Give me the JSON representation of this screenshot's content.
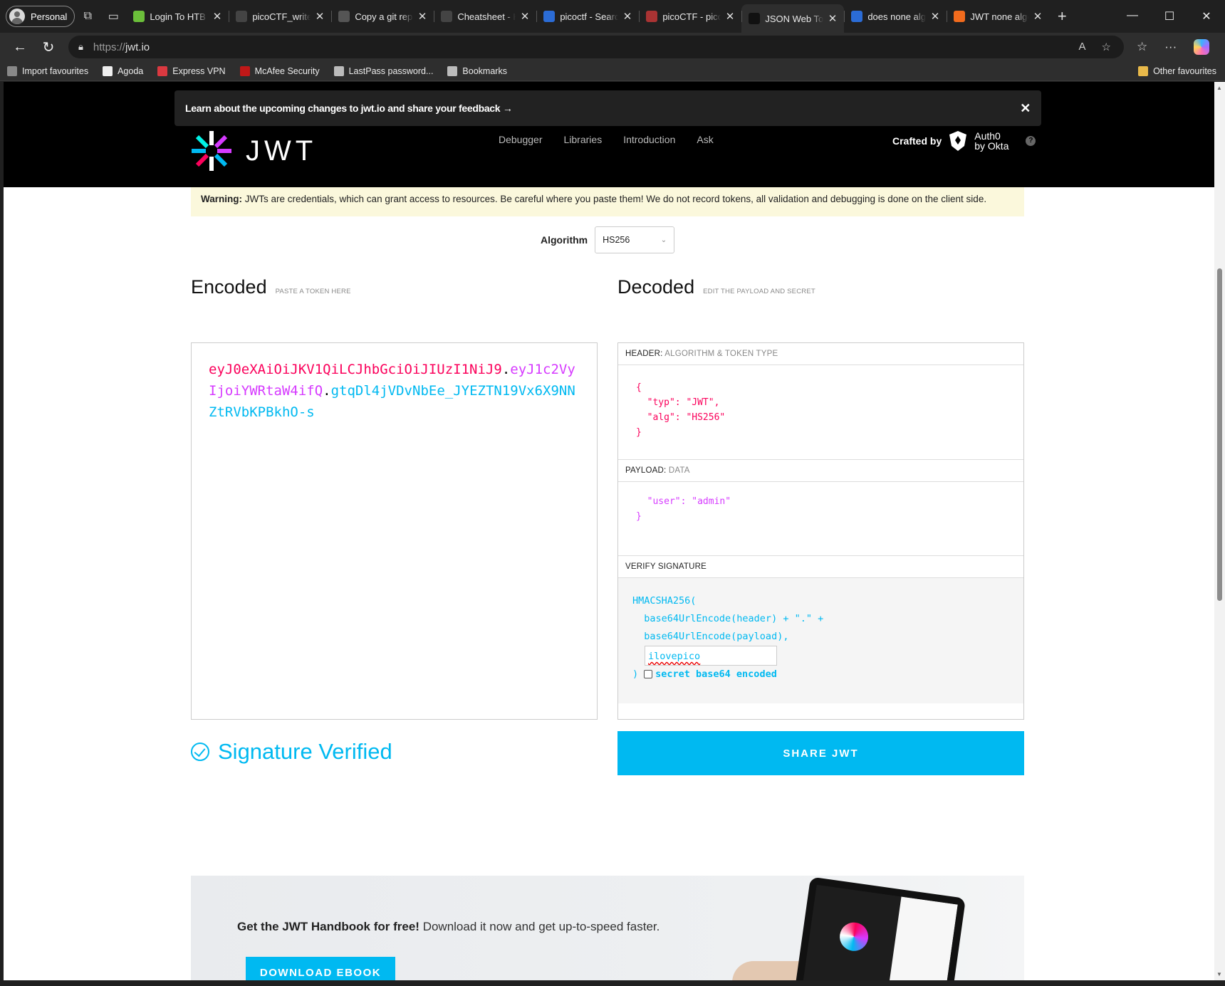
{
  "browser": {
    "profile": "Personal",
    "tabs": [
      {
        "title": "Login To HTB Ac",
        "color": "#6bbf3a"
      },
      {
        "title": "picoCTF_writeup",
        "color": "#444"
      },
      {
        "title": "Copy a git repo",
        "color": "#555"
      },
      {
        "title": "Cheatsheet - Ho",
        "color": "#444"
      },
      {
        "title": "picoctf - Search",
        "color": "#2b6cd6"
      },
      {
        "title": "picoCTF - picoG",
        "color": "#a33"
      },
      {
        "title": "JSON Web Toke",
        "color": "#111"
      },
      {
        "title": "does none algo",
        "color": "#2b6cd6"
      },
      {
        "title": "JWT none algor",
        "color": "#f26b1d"
      }
    ],
    "url_protocol": "https://",
    "url_host": "jwt.io",
    "bookmarks": [
      {
        "label": "Import favourites",
        "color": "#888"
      },
      {
        "label": "Agoda",
        "color": "#eee"
      },
      {
        "label": "Express VPN",
        "color": "#da3940"
      },
      {
        "label": "McAfee Security",
        "color": "#c01818"
      },
      {
        "label": "LastPass password...",
        "color": "#bbb"
      },
      {
        "label": "Bookmarks",
        "color": "#bbb"
      }
    ],
    "other_favourites": "Other favourites"
  },
  "site": {
    "banner": "Learn about the upcoming changes to jwt.io and share your feedback →",
    "logo_text": "JWT",
    "nav": [
      "Debugger",
      "Libraries",
      "Introduction",
      "Ask"
    ],
    "crafted_by": "Crafted by",
    "auth0_line1": "Auth0",
    "auth0_line2": "by Okta",
    "warning_label": "Warning:",
    "warning_text": " JWTs are credentials, which can grant access to resources. Be careful where you paste them! We do not record tokens, all validation and debugging is done on the client side."
  },
  "debugger": {
    "algorithm_label": "Algorithm",
    "algorithm": "HS256",
    "encoded_title": "Encoded",
    "encoded_hint": "PASTE A TOKEN HERE",
    "decoded_title": "Decoded",
    "decoded_hint": "EDIT THE PAYLOAD AND SECRET",
    "token_header": "eyJ0eXAiOiJKV1QiLCJhbGciOiJIUzI1NiJ9",
    "token_payload": "eyJ1c2VyIjoiYWRtaW4ifQ",
    "token_signature": "gtqDl4jVDvNbEe_JYEZTN19Vx6X9NNZtRVbKPBkhO-s",
    "dot": ".",
    "header_label": "HEADER:",
    "header_hint": "ALGORITHM & TOKEN TYPE",
    "header_json": "{\n  \"typ\": \"JWT\",\n  \"alg\": \"HS256\"\n}",
    "payload_label": "PAYLOAD:",
    "payload_hint": "DATA",
    "payload_json": "  \"user\": \"admin\"\n}",
    "verify_label": "VERIFY SIGNATURE",
    "verify_fn": "HMACSHA256(",
    "verify_line2": "  base64UrlEncode(header) + \".\" +",
    "verify_line3": "  base64UrlEncode(payload),",
    "secret": "ilovepico",
    "verify_close": ")",
    "secret_b64_label": "secret base64 encoded",
    "status": "Signature Verified",
    "share_button": "SHARE JWT"
  },
  "ebook": {
    "bold": "Get the JWT Handbook for free!",
    "text": " Download it now and get up-to-speed faster.",
    "button": "DOWNLOAD EBOOK"
  }
}
